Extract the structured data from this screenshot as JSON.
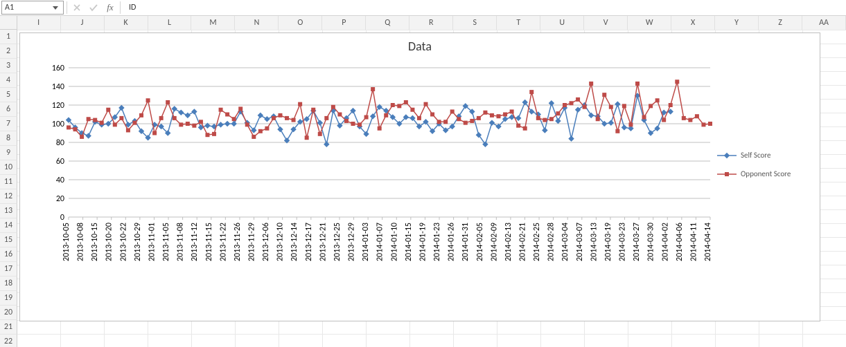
{
  "formula_bar": {
    "cell_ref": "A1",
    "value": "ID",
    "fx_label": "fx"
  },
  "columns": [
    "I",
    "J",
    "K",
    "L",
    "M",
    "N",
    "O",
    "P",
    "Q",
    "R",
    "S",
    "T",
    "U",
    "V",
    "W",
    "X",
    "Y",
    "Z",
    "AA"
  ],
  "rows": [
    1,
    2,
    3,
    4,
    5,
    6,
    7,
    8,
    9,
    10,
    11,
    12,
    13,
    14,
    15,
    16,
    17,
    18,
    19,
    20,
    21,
    22
  ],
  "chart_data": {
    "type": "line",
    "title": "Data",
    "xlabel": "",
    "ylabel": "",
    "ylim": [
      0,
      160
    ],
    "yticks": [
      0,
      20,
      40,
      60,
      80,
      100,
      120,
      140,
      160
    ],
    "categories": [
      "2013-10-05",
      "2013-10-08",
      "2013-10-15",
      "2013-10-20",
      "2013-10-22",
      "2013-10-29",
      "2013-11-01",
      "2013-11-05",
      "2013-11-08",
      "2013-11-12",
      "2013-11-15",
      "2013-11-22",
      "2013-11-26",
      "2013-11-29",
      "2013-12-06",
      "2013-12-10",
      "2013-12-14",
      "2013-12-17",
      "2013-12-21",
      "2013-12-25",
      "2013-12-29",
      "2014-01-03",
      "2014-01-07",
      "2014-01-10",
      "2014-01-15",
      "2014-01-19",
      "2014-01-23",
      "2014-01-26",
      "2014-01-31",
      "2014-02-05",
      "2014-02-09",
      "2014-02-13",
      "2014-02-21",
      "2014-02-25",
      "2014-02-28",
      "2014-03-04",
      "2014-03-07",
      "2014-03-13",
      "2014-03-19",
      "2014-03-23",
      "2014-03-27",
      "2014-03-30",
      "2014-04-02",
      "2014-04-06",
      "2014-04-11",
      "2014-04-14"
    ],
    "series": [
      {
        "name": "Self Score",
        "color": "#4a7ebb",
        "marker": "diamond",
        "values": [
          104,
          96,
          90,
          87,
          102,
          99,
          100,
          107,
          117,
          99,
          103,
          92,
          85,
          99,
          97,
          90,
          116,
          112,
          109,
          113,
          96,
          98,
          97,
          99,
          100,
          100,
          113,
          101,
          93,
          109,
          105,
          108,
          94,
          82,
          94,
          102,
          105,
          114,
          101,
          78,
          114,
          98,
          106,
          114,
          97,
          89,
          108,
          118,
          114,
          107,
          100,
          107,
          106,
          97,
          102,
          92,
          100,
          93,
          97,
          108,
          119,
          113,
          88,
          78,
          101,
          97,
          105,
          107,
          106,
          123,
          113,
          110,
          93,
          122,
          103,
          117,
          84,
          115,
          120,
          109,
          108,
          100,
          101,
          121,
          96,
          95,
          130,
          104,
          90,
          95,
          112,
          113
        ]
      },
      {
        "name": "Opponent Score",
        "color": "#be4b48",
        "marker": "square",
        "values": [
          96,
          94,
          86,
          105,
          104,
          101,
          115,
          99,
          106,
          93,
          101,
          109,
          125,
          90,
          106,
          123,
          106,
          99,
          100,
          98,
          102,
          88,
          89,
          115,
          110,
          105,
          116,
          99,
          86,
          92,
          95,
          106,
          109,
          106,
          104,
          121,
          85,
          115,
          89,
          106,
          118,
          110,
          103,
          100,
          99,
          107,
          137,
          95,
          109,
          120,
          119,
          123,
          115,
          106,
          121,
          110,
          102,
          102,
          113,
          105,
          101,
          103,
          106,
          112,
          109,
          108,
          110,
          113,
          98,
          95,
          134,
          106,
          104,
          105,
          111,
          120,
          122,
          126,
          118,
          143,
          105,
          131,
          118,
          92,
          119,
          99,
          143,
          107,
          119,
          125,
          104,
          120,
          145,
          106,
          104,
          108,
          99,
          100
        ]
      }
    ],
    "legend": {
      "position": "right"
    }
  },
  "legend_labels": {
    "self": "Self Score",
    "opp": "Opponent Score"
  }
}
